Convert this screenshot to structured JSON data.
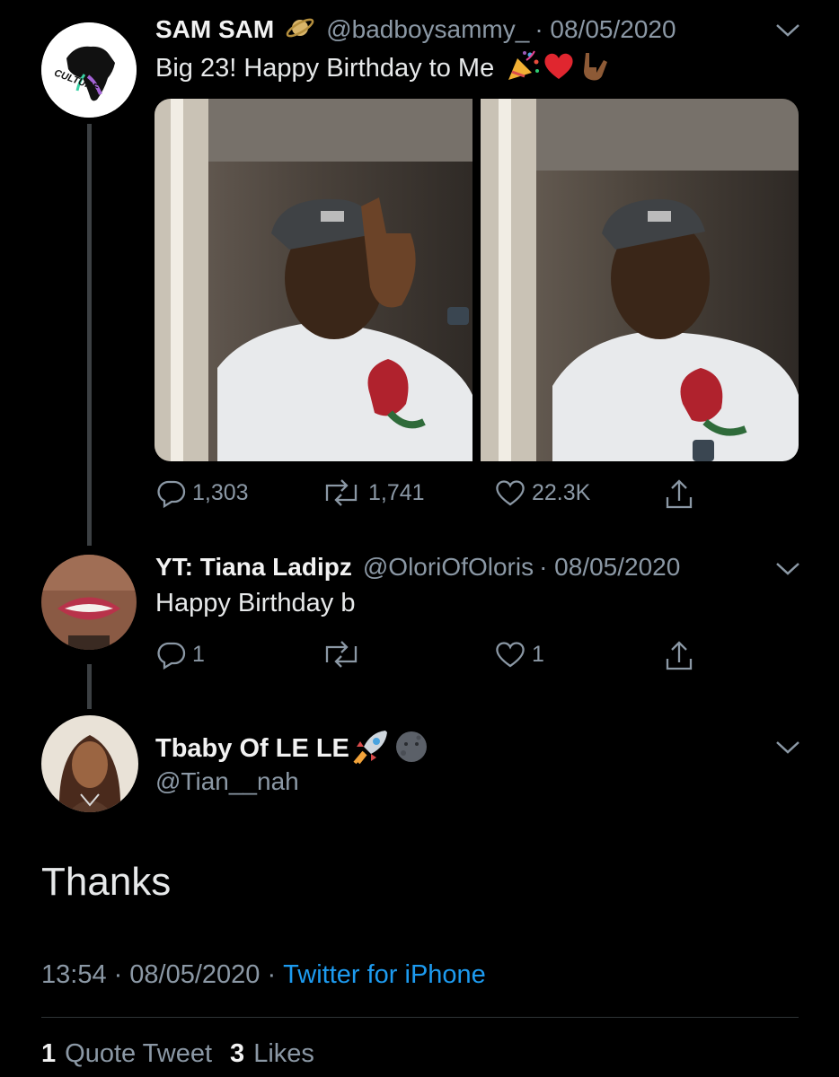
{
  "tweet1": {
    "name": "SAM SAM",
    "handle": "@badboysammy_",
    "date": "· 08/05/2020",
    "text": "Big 23! Happy Birthday to Me",
    "avatar_text": "CULTURE",
    "replies": "1,303",
    "retweets": "1,741",
    "likes": "22.3K"
  },
  "tweet2": {
    "name": "YT: Tiana Ladipz",
    "handle": "@OloriOfOloris",
    "date": "· 08/05/2020",
    "text": "Happy Birthday b",
    "replies": "1",
    "retweets": "",
    "likes": "1"
  },
  "main": {
    "name": "Tbaby Of LE LE",
    "handle": "@Tian__nah",
    "text": "Thanks",
    "time": "13:54",
    "date": "· 08/05/2020 ·",
    "source": "Twitter for iPhone",
    "quote_count": "1",
    "quote_label": "Quote Tweet",
    "likes_count": "3",
    "likes_label": "Likes"
  },
  "colors": {
    "background": "#000000",
    "link": "#1d9bf0",
    "muted": "#8b98a5"
  },
  "icons": [
    "saturn-icon",
    "party-popper-icon",
    "red-heart-icon",
    "love-you-gesture-icon",
    "rocket-icon",
    "new-moon-face-icon"
  ]
}
